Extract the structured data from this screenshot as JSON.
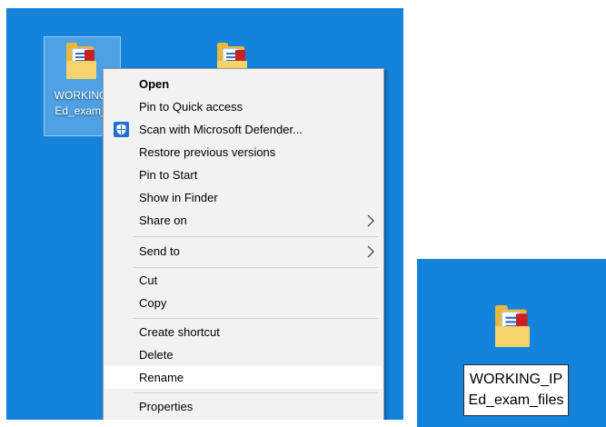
{
  "desktop": {
    "selected_icon_label": "WORKING_IPEd_exam_files",
    "selected_icon_label_visible": [
      "WORKING",
      "Ed_exam_"
    ]
  },
  "context_menu": {
    "items": [
      {
        "label": "Open",
        "bold": true
      },
      {
        "label": "Pin to Quick access"
      },
      {
        "label": "Scan with Microsoft Defender...",
        "icon": "microsoft-defender-icon"
      },
      {
        "label": "Restore previous versions"
      },
      {
        "label": "Pin to Start"
      },
      {
        "label": "Show in Finder"
      },
      {
        "label": "Share on",
        "submenu": true
      },
      {
        "label": "Send to",
        "submenu": true
      },
      {
        "label": "Cut"
      },
      {
        "label": "Copy"
      },
      {
        "label": "Create shortcut"
      },
      {
        "label": "Delete"
      },
      {
        "label": "Rename",
        "highlighted": true
      },
      {
        "label": "Properties"
      }
    ]
  },
  "inset": {
    "label_line1": "WORKING_IP",
    "label_line2": "Ed_exam_files"
  },
  "colors": {
    "desktop_background": "#1483dc",
    "menu_background": "#f2f2f2",
    "highlight": "#ffffff"
  }
}
